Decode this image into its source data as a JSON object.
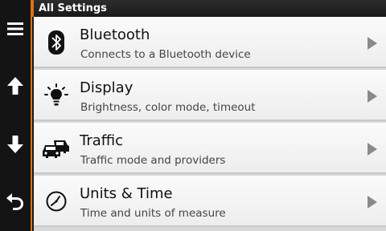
{
  "header": {
    "title": "All Settings"
  },
  "rail": {
    "menu_icon": "hamburger-menu-icon",
    "up_icon": "arrow-up-icon",
    "down_icon": "arrow-down-icon",
    "back_icon": "back-arrow-icon"
  },
  "colors": {
    "accent": "#d9731a",
    "rail_bg": "#141414",
    "row_bg": "#f5f5f5"
  },
  "items": [
    {
      "title": "Bluetooth",
      "subtitle": "Connects to a Bluetooth device",
      "icon": "bluetooth-icon"
    },
    {
      "title": "Display",
      "subtitle": "Brightness, color mode, timeout",
      "icon": "lightbulb-icon"
    },
    {
      "title": "Traffic",
      "subtitle": "Traffic mode and providers",
      "icon": "traffic-cars-icon"
    },
    {
      "title": "Units & Time",
      "subtitle": "Time and units of measure",
      "icon": "clock-icon"
    }
  ]
}
